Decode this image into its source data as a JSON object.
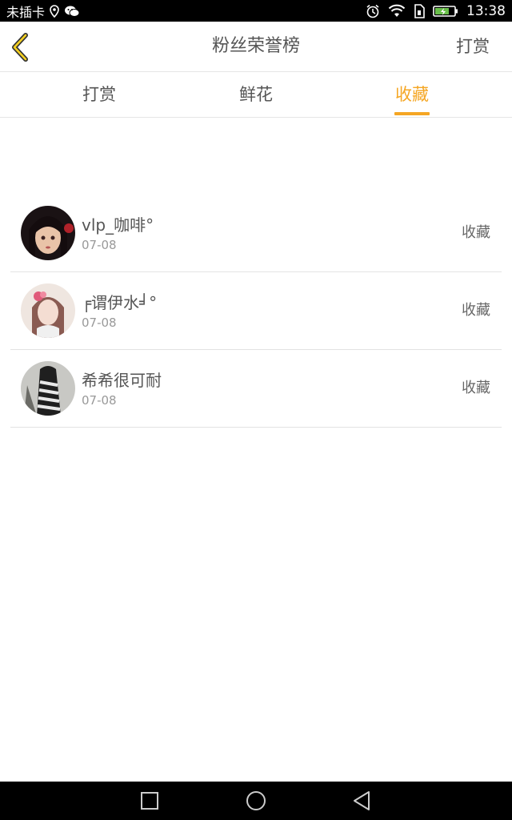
{
  "status_bar": {
    "carrier": "未插卡",
    "time": "13:38",
    "icons": [
      "location-icon",
      "wechat-icon",
      "alarm-icon",
      "wifi-icon",
      "sim-icon",
      "battery-icon"
    ]
  },
  "header": {
    "title": "粉丝荣誉榜",
    "action_label": "打赏"
  },
  "tabs": [
    {
      "label": "打赏",
      "active": false
    },
    {
      "label": "鲜花",
      "active": false
    },
    {
      "label": "收藏",
      "active": true
    }
  ],
  "list": [
    {
      "name": "vlp_咖啡°",
      "date": "07-08",
      "action": "收藏"
    },
    {
      "name": "╒谓伊水╛°",
      "date": "07-08",
      "action": "收藏"
    },
    {
      "name": "希希很可耐",
      "date": "07-08",
      "action": "收藏"
    }
  ],
  "colors": {
    "accent": "#f5a623",
    "status_bar_bg": "#000000",
    "nav_bar_bg": "#000000",
    "divider": "#e6e6e6"
  },
  "nav_bar": {
    "buttons": [
      "recent-apps-icon",
      "home-icon",
      "back-nav-icon"
    ]
  }
}
